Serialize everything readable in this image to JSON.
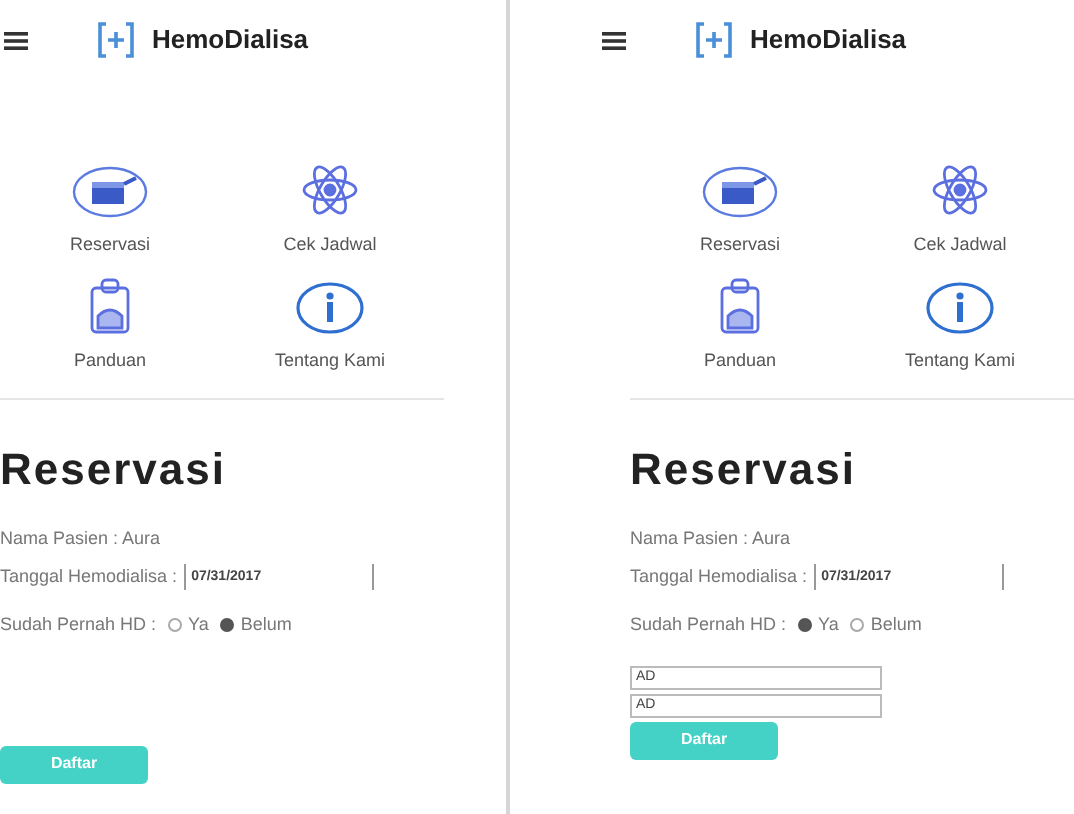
{
  "screens": [
    {
      "app_name": "HemoDialisa",
      "menu": [
        {
          "label": "Reservasi",
          "kind": "calendar"
        },
        {
          "label": "Cek Jadwal",
          "kind": "atom"
        },
        {
          "label": "Panduan",
          "kind": "clipboard"
        },
        {
          "label": "Tentang Kami",
          "kind": "info"
        }
      ],
      "title": "Reservasi",
      "patient": "Nama Pasien : Aura",
      "date_label": "Tanggal Hemodialisa :",
      "date_value": "07/31/2017",
      "hd_label": "Sudah Pernah HD :",
      "hd_options": [
        {
          "label": "Ya",
          "selected": false
        },
        {
          "label": "Belum",
          "selected": true
        }
      ],
      "button": "Daftar"
    },
    {
      "app_name": "HemoDialisa",
      "menu": [
        {
          "label": "Reservasi",
          "kind": "calendar"
        },
        {
          "label": "Cek Jadwal",
          "kind": "atom"
        },
        {
          "label": "Panduan",
          "kind": "clipboard"
        },
        {
          "label": "Tentang Kami",
          "kind": "info"
        }
      ],
      "title": "Reservasi",
      "patient": "Nama Pasien : Aura",
      "date_label": "Tanggal Hemodialisa :",
      "date_value": "07/31/2017",
      "hd_label": "Sudah Pernah HD :",
      "hd_options": [
        {
          "label": "Ya",
          "selected": true
        },
        {
          "label": "Belum",
          "selected": false
        }
      ],
      "extra_fields": [
        {
          "value": "AD"
        },
        {
          "value": "AD"
        }
      ],
      "button": "Daftar"
    }
  ]
}
